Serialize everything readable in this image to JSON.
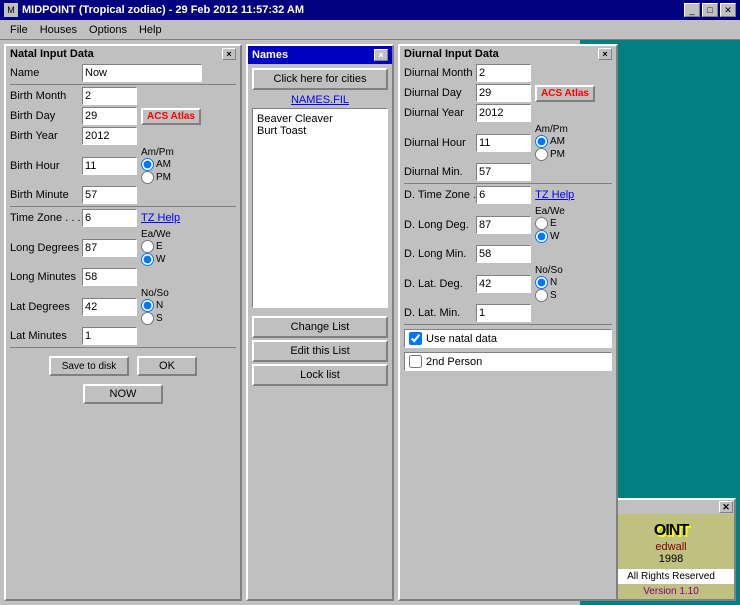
{
  "titleBar": {
    "icon": "M",
    "title": "MIDPOINT (Tropical zodiac) - 29 Feb 2012   11:57:32 AM",
    "minimize": "_",
    "maximize": "□",
    "close": "✕"
  },
  "menu": {
    "items": [
      "File",
      "Houses",
      "Options",
      "Help"
    ]
  },
  "natal": {
    "title": "Natal Input Data",
    "nameLabel": "Name",
    "nameValue": "Now",
    "fields": [
      {
        "label": "Birth Month",
        "value": "2"
      },
      {
        "label": "Birth Day",
        "value": "29"
      },
      {
        "label": "Birth Year",
        "value": "2012"
      },
      {
        "label": "Birth Hour",
        "value": "11"
      },
      {
        "label": "Birth Minute",
        "value": "57"
      },
      {
        "label": "Time Zone . . .",
        "value": "6"
      },
      {
        "label": "Long Degrees",
        "value": "87"
      },
      {
        "label": "Long Minutes",
        "value": "58"
      },
      {
        "label": "Lat Degrees",
        "value": "42"
      },
      {
        "label": "Lat Minutes",
        "value": "1"
      }
    ],
    "amPmLabel": "Am/Pm",
    "amLabel": "AM",
    "pmLabel": "PM",
    "amSelected": true,
    "eaWeLabel": "Ea/We",
    "eLabel": "E",
    "wLabel": "W",
    "wSelected": true,
    "noSoLabel": "No/So",
    "nLabel": "N",
    "sLabel": "S",
    "nSelected": true,
    "acsAtlasLabel": "ACS Atlas",
    "tzHelpLabel": "TZ Help",
    "saveToDisk": "Save to disk",
    "nowButton": "NOW",
    "okButton": "OK"
  },
  "names": {
    "title": "Names",
    "clickHereLabel": "Click here for cities",
    "fileLabel": "NAMES.FIL",
    "listItems": [
      "Beaver Cleaver",
      "Burt Toast"
    ],
    "changeListLabel": "Change List",
    "editListLabel": "Edit this List",
    "lockListLabel": "Lock list"
  },
  "diurnal": {
    "title": "Diurnal Input Data",
    "fields": [
      {
        "label": "Diurnal Month",
        "value": "2"
      },
      {
        "label": "Diurnal Day",
        "value": "29"
      },
      {
        "label": "Diurnal Year",
        "value": "2012"
      },
      {
        "label": "Diurnal Hour",
        "value": "11"
      },
      {
        "label": "Diurnal Min.",
        "value": "57"
      },
      {
        "label": "D. Time Zone .",
        "value": "6"
      },
      {
        "label": "D. Long Deg.",
        "value": "87"
      },
      {
        "label": "D. Long Min.",
        "value": "58"
      },
      {
        "label": "D. Lat. Deg.",
        "value": "42"
      },
      {
        "label": "D. Lat. Min.",
        "value": "1"
      }
    ],
    "amPmLabel": "Am/Pm",
    "amLabel": "AM",
    "pmLabel": "PM",
    "amSelected": true,
    "eaWeLabel": "Ea/We",
    "eLabel": "E",
    "wLabel": "W",
    "wSelected": true,
    "noSoLabel": "No/So",
    "nLabel": "N",
    "sLabel": "S",
    "nSelected": true,
    "acsAtlasLabel": "ACS Atlas",
    "tzHelpLabel": "TZ Help",
    "useNatalDataLabel": "Use natal data",
    "useNatalChecked": true,
    "secondPersonLabel": "2nd Person"
  },
  "info": {
    "closeBtn": "✕",
    "title": "OINT",
    "subTitle": "edwall",
    "year": "1998",
    "rights": "All Rights Reserved",
    "version": "Version 1.10"
  }
}
